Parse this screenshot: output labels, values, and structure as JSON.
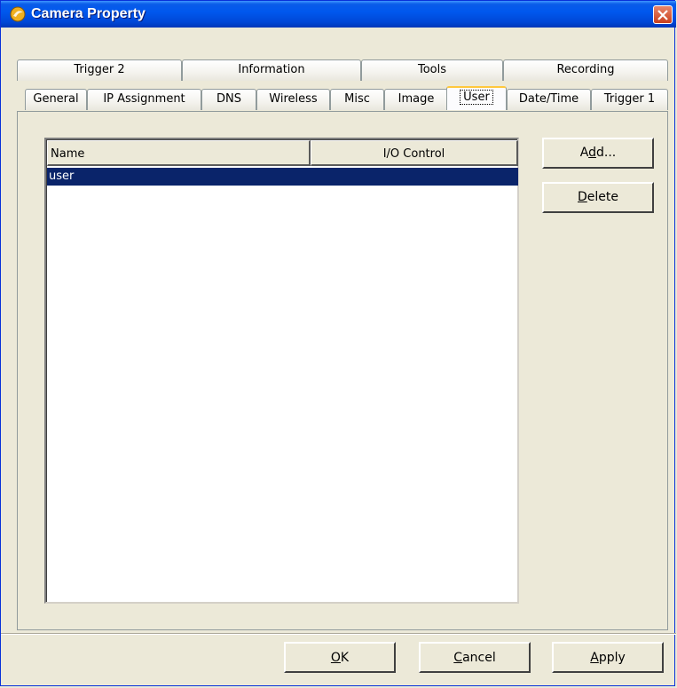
{
  "window": {
    "title": "Camera Property",
    "icon": "camera-property-icon",
    "close_icon": "close-icon"
  },
  "tabs": {
    "row_back": [
      {
        "label": "Trigger 2"
      },
      {
        "label": "Information"
      },
      {
        "label": "Tools"
      },
      {
        "label": "Recording"
      }
    ],
    "row_front": [
      {
        "label": "General"
      },
      {
        "label": "IP Assignment"
      },
      {
        "label": "DNS"
      },
      {
        "label": "Wireless"
      },
      {
        "label": "Misc"
      },
      {
        "label": "Image"
      },
      {
        "label": "User"
      },
      {
        "label": "Date/Time"
      },
      {
        "label": "Trigger 1"
      }
    ],
    "active": "User"
  },
  "user_list": {
    "columns": [
      "Name",
      "I/O Control"
    ],
    "rows": [
      {
        "name": "user",
        "io_control": "",
        "selected": true
      }
    ]
  },
  "side_buttons": {
    "add": {
      "pre": "A",
      "mnemonic": "d",
      "post": "d..."
    },
    "delete": {
      "pre": "",
      "mnemonic": "D",
      "post": "elete"
    }
  },
  "dialog_buttons": {
    "ok": {
      "pre": "",
      "mnemonic": "O",
      "post": "K"
    },
    "cancel": {
      "pre": "",
      "mnemonic": "C",
      "post": "ancel"
    },
    "apply": {
      "pre": "",
      "mnemonic": "A",
      "post": "pply"
    }
  },
  "colors": {
    "titlebar": "#0058EE",
    "selection": "#0A246A",
    "face": "#ECE9D8",
    "active_tab_highlight": "#FFC83C"
  }
}
